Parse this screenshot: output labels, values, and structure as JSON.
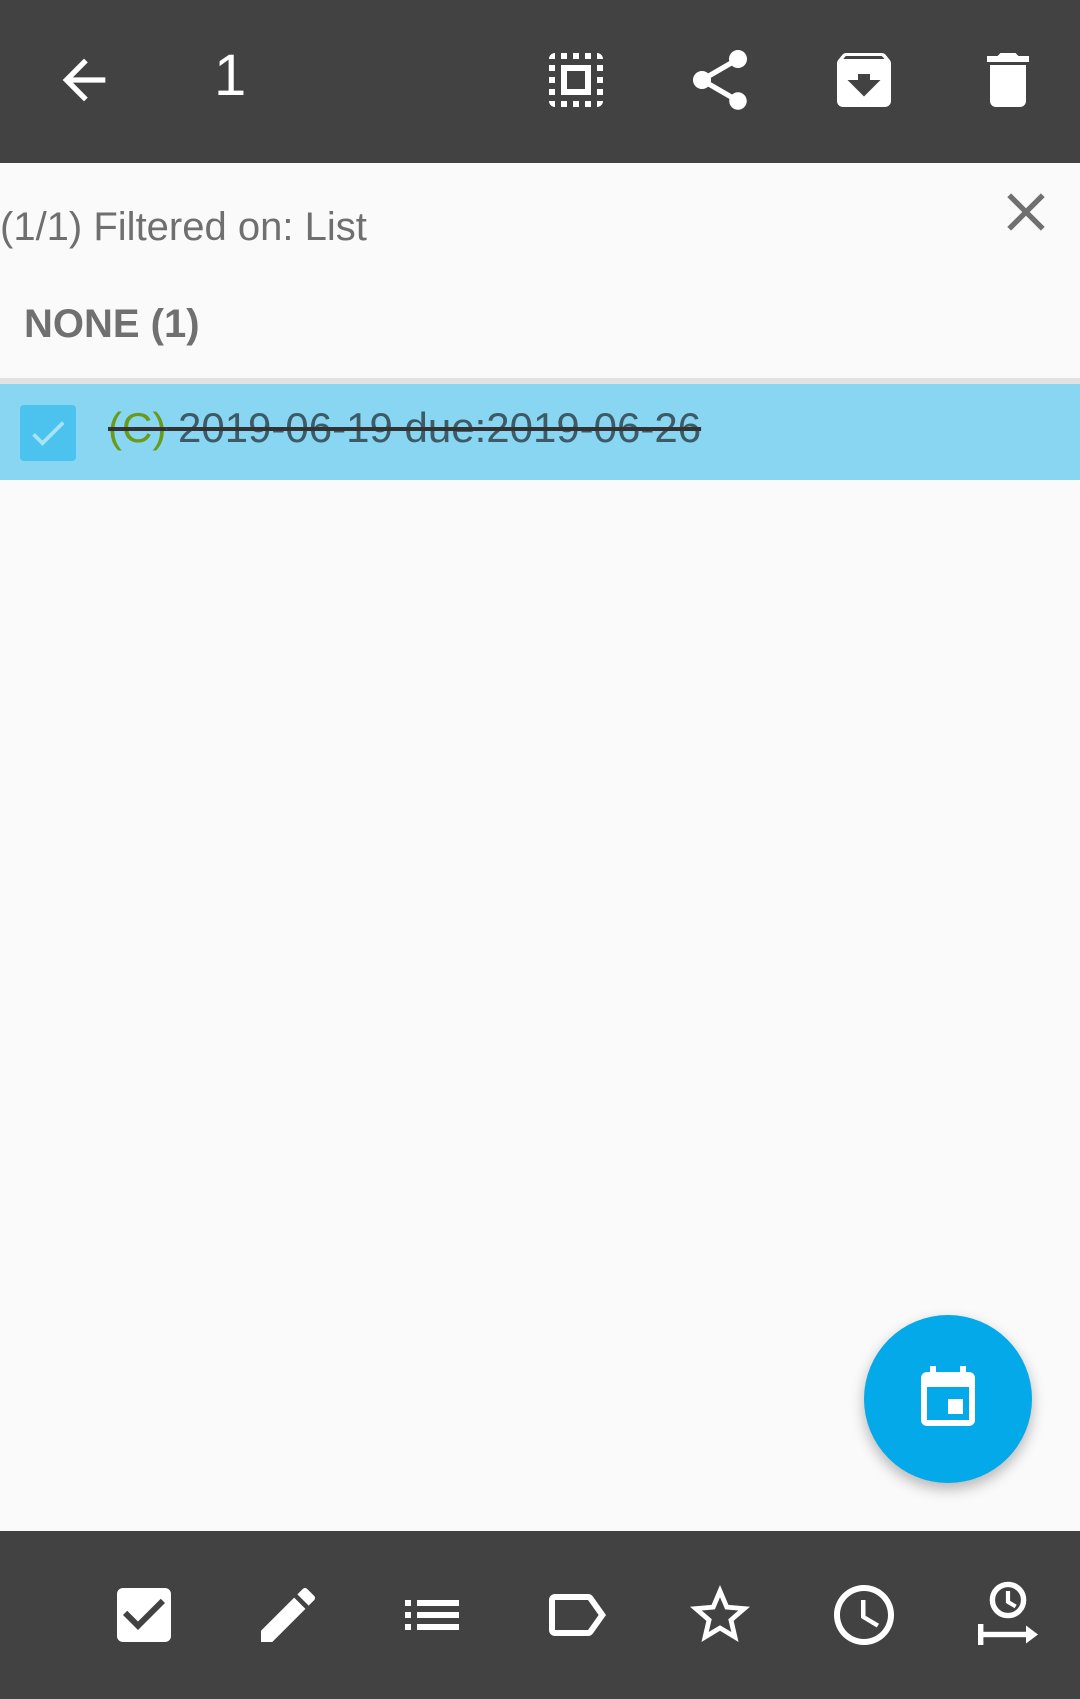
{
  "toolbar": {
    "selected_count": "1",
    "icons": [
      "back-arrow-icon",
      "select-all-icon",
      "share-icon",
      "archive-icon",
      "delete-icon"
    ]
  },
  "filter": {
    "text": "(1/1) Filtered on: List",
    "close_icon": "close-icon"
  },
  "section": {
    "header": "NONE (1)"
  },
  "tasks": [
    {
      "checked": true,
      "priority": "(C)",
      "text": "2019-06-19  due:2019-06-26"
    }
  ],
  "fab": {
    "icon": "calendar-icon",
    "color": "#03a9e8"
  },
  "bottom_toolbar": {
    "icons": [
      "complete-checkbox-icon",
      "edit-pencil-icon",
      "list-icon",
      "tag-icon",
      "star-icon",
      "clock-icon",
      "threshold-clock-icon"
    ]
  },
  "colors": {
    "appbar": "#424242",
    "selected_row": "#88d6f1",
    "priority_text": "#6a9a1a",
    "background": "#fafafa"
  }
}
